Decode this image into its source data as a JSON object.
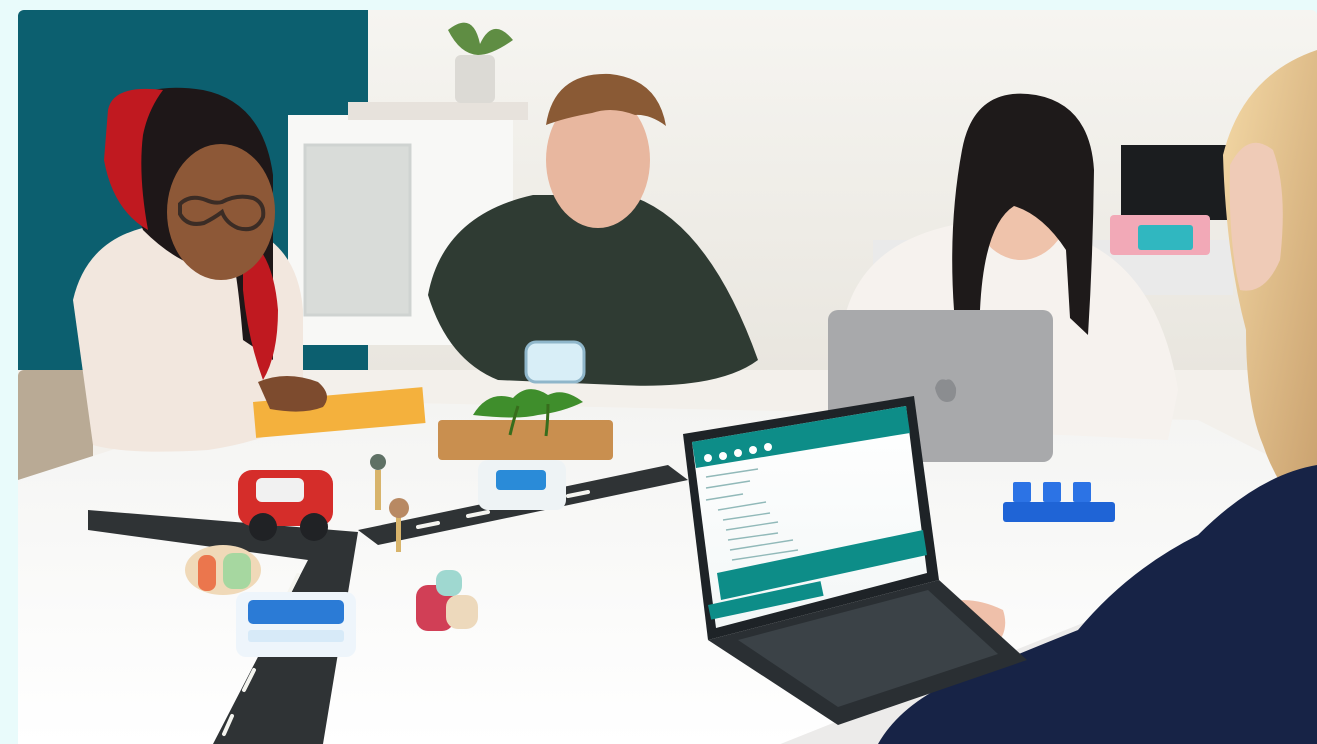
{
  "photo": {
    "subject": "classroom-coding-scene",
    "colors": {
      "page_background": "#e9fbfb",
      "wall_teal": "#0c5f6f",
      "wall_white": "#f4f2ee",
      "table": "#f7f7f6",
      "laptop_screen_accent": "#0d8d88",
      "road": "#2f3335",
      "notepad": "#f4b13d",
      "blue_blocks": "#1f64d6",
      "red_truck": "#d52d2a"
    }
  }
}
